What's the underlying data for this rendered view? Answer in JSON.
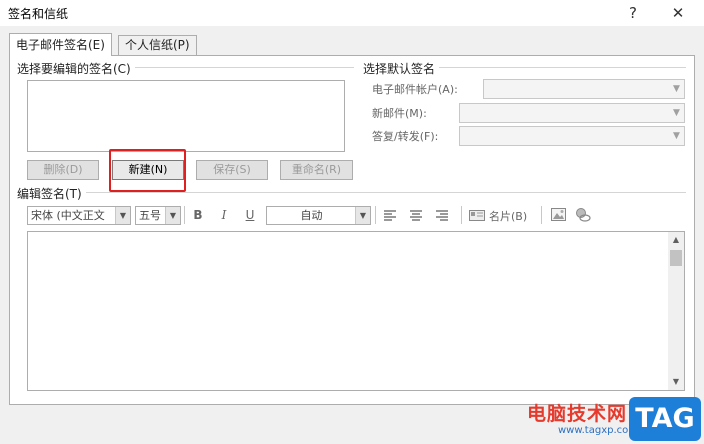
{
  "window": {
    "title": "签名和信纸",
    "help_label": "?",
    "close_label": "✕"
  },
  "tabs": [
    {
      "label": "电子邮件签名(E)",
      "active": true
    },
    {
      "label": "个人信纸(P)",
      "active": false
    }
  ],
  "select_signature": {
    "group_label": "选择要编辑的签名(C)",
    "buttons": {
      "delete": {
        "label": "删除(D)",
        "enabled": false
      },
      "new": {
        "label": "新建(N)",
        "enabled": true
      },
      "save": {
        "label": "保存(S)",
        "enabled": false
      },
      "rename": {
        "label": "重命名(R)",
        "enabled": false
      }
    }
  },
  "default_signature": {
    "group_label": "选择默认签名",
    "email_account_label": "电子邮件帐户(A):",
    "new_messages_label": "新邮件(M):",
    "replies_label": "答复/转发(F):"
  },
  "edit_signature": {
    "group_label": "编辑签名(T)",
    "font_value": "宋体 (中文正文",
    "size_value": "五号",
    "bold_label": "B",
    "italic_label": "I",
    "underline_label": "U",
    "color_value": "自动",
    "business_card_label": "名片(B)",
    "icons": [
      "align-left-icon",
      "align-center-icon",
      "align-right-icon",
      "business-card-icon",
      "insert-picture-icon",
      "hyperlink-icon"
    ]
  },
  "watermark": {
    "site_text": "电脑技术网",
    "url": "www.tagxp.com",
    "tag": "TAG"
  },
  "colors": {
    "highlight": "#e02020",
    "watermark_red": "#e53a2c",
    "tag_blue": "#1e7fd9"
  }
}
